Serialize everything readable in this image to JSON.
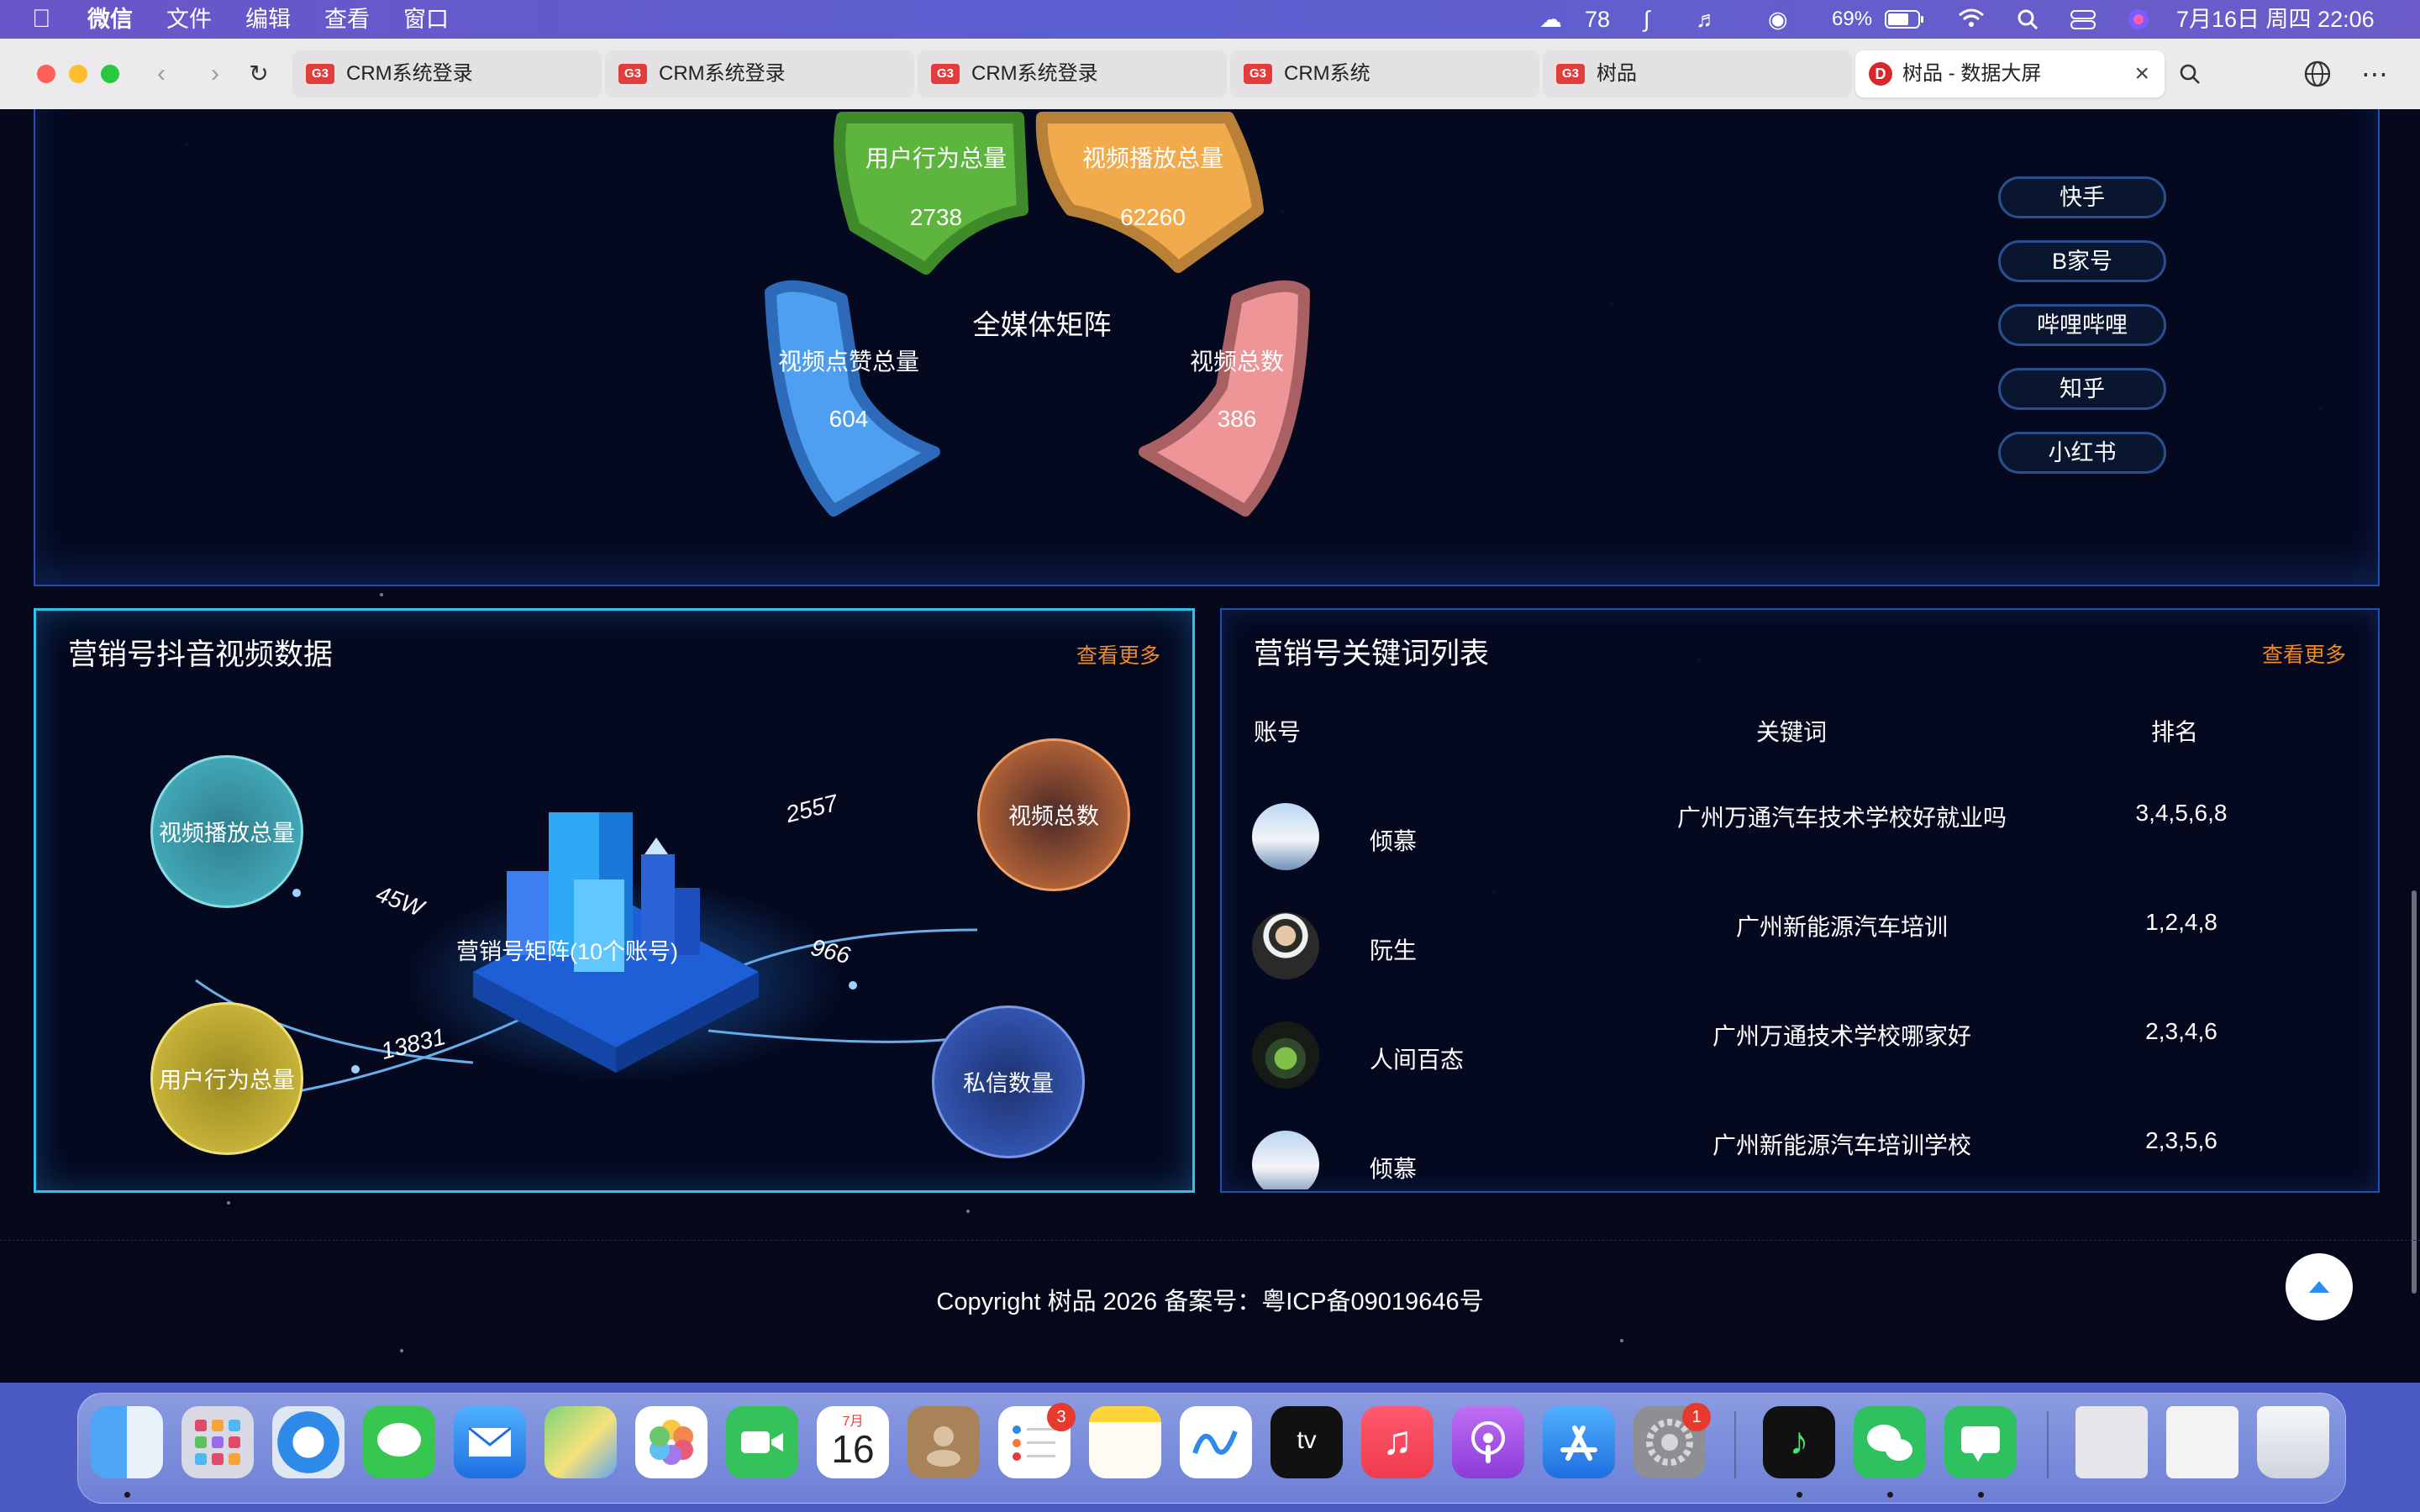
{
  "menubar": {
    "app": "微信",
    "menus": [
      "文件",
      "编辑",
      "查看",
      "窗口"
    ],
    "wechat_count": "78",
    "battery": "69%",
    "datetime": "7月16日 周四  22:06"
  },
  "browser": {
    "tabs": [
      {
        "label": "CRM系统登录",
        "icon": "G3"
      },
      {
        "label": "CRM系统登录",
        "icon": "G3"
      },
      {
        "label": "CRM系统登录",
        "icon": "G3"
      },
      {
        "label": "CRM系统",
        "icon": "G3"
      },
      {
        "label": "树品",
        "icon": "G3"
      },
      {
        "label": "树品 - 数据大屏",
        "icon": "D"
      }
    ]
  },
  "matrix": {
    "center_label": "全媒体矩阵",
    "petals": [
      {
        "label": "用户行为总量",
        "value": "2738",
        "color": "#5db53e"
      },
      {
        "label": "视频播放总量",
        "value": "62260",
        "color": "#f2ab4c"
      },
      {
        "label": "视频点赞总量",
        "value": "604",
        "color": "#4f9ff0"
      },
      {
        "label": "视频总数",
        "value": "386",
        "color": "#ee9597"
      }
    ],
    "platforms": [
      "快手",
      "B家号",
      "哔哩哔哩",
      "知乎",
      "小红书"
    ]
  },
  "video_panel": {
    "title": "营销号抖音视频数据",
    "more": "查看更多",
    "center_label": "营销号矩阵(10个账号)",
    "nodes": [
      {
        "label": "视频播放总量",
        "value": "45W",
        "color": "#4ab7c6"
      },
      {
        "label": "用户行为总量",
        "value": "13831",
        "color": "#d8c341"
      },
      {
        "label": "视频总数",
        "value": "2557",
        "color": "#d7773c"
      },
      {
        "label": "私信数量",
        "value": "966",
        "color": "#3a63c9"
      }
    ]
  },
  "keyword_panel": {
    "title": "营销号关键词列表",
    "more": "查看更多",
    "headers": {
      "account": "账号",
      "keyword": "关键词",
      "rank": "排名"
    },
    "rows": [
      {
        "account": "倾慕",
        "keyword": "广州万通汽车技术学校好就业吗",
        "rank": "3,4,5,6,8",
        "avatar": "sky-avatar"
      },
      {
        "account": "阮生",
        "keyword": "广州新能源汽车培训",
        "rank": "1,2,4,8",
        "avatar": "person-avatar"
      },
      {
        "account": "人间百态",
        "keyword": "广州万通技术学校哪家好",
        "rank": "2,3,4,6",
        "avatar": "plant-avatar"
      },
      {
        "account": "倾慕",
        "keyword": "广州新能源汽车培训学校",
        "rank": "2,3,5,6",
        "avatar": "sky-avatar"
      }
    ]
  },
  "footer": {
    "copyright": "Copyright 树品 2026 备案号：粤ICP备09019646号"
  },
  "dock": {
    "calendar_month": "7月",
    "calendar_day": "16",
    "reminders_badge": "3",
    "settings_badge": "1"
  }
}
